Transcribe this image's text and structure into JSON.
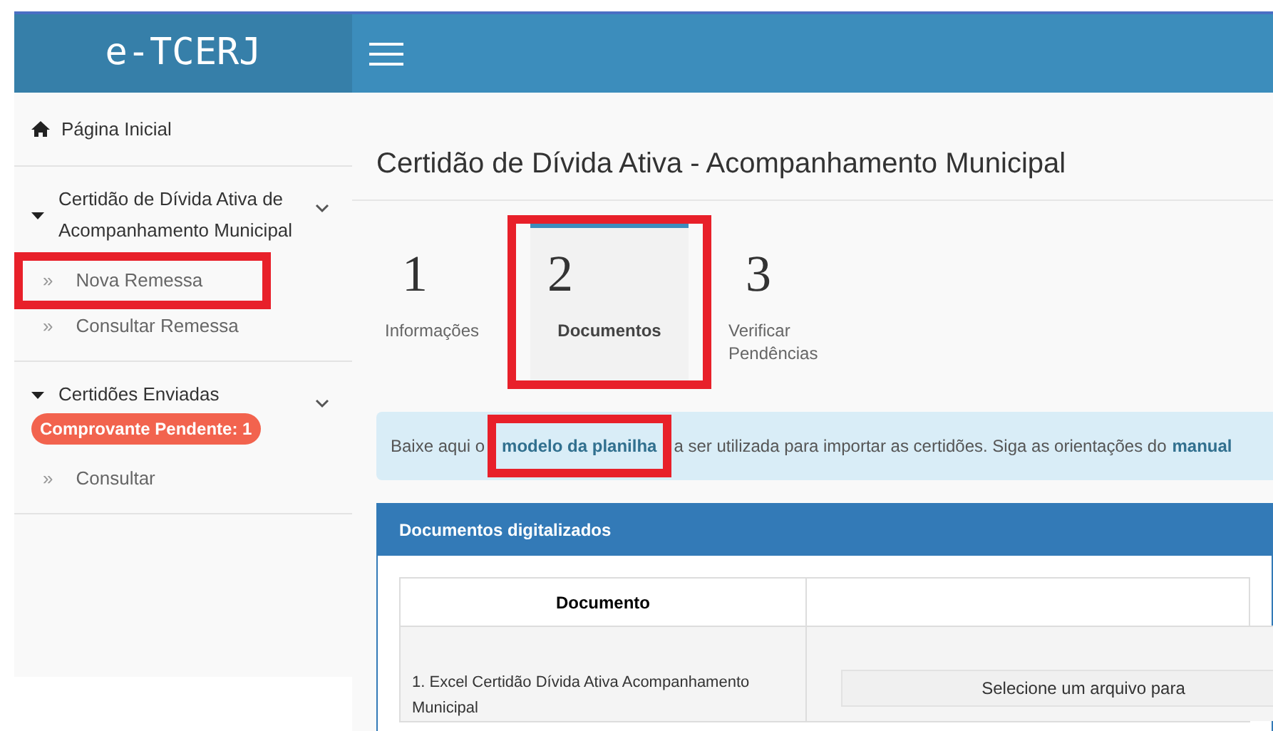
{
  "logo": "e-TCERJ",
  "sidebar": {
    "items": [
      {
        "kind": "link",
        "label": "Página Inicial"
      },
      {
        "kind": "group",
        "label": "Certidão de Dívida Ativa de Acompanhamento Municipal",
        "expanded": true,
        "children": [
          {
            "bullet": "»",
            "label": "Nova Remessa",
            "highlighted": true
          },
          {
            "bullet": "»",
            "label": "Consultar Remessa",
            "highlighted": false
          }
        ]
      },
      {
        "kind": "group",
        "label": "Certidões Enviadas",
        "badge": "Comprovante Pendente: 1",
        "expanded": true,
        "children": [
          {
            "bullet": "»",
            "label": "Consultar",
            "highlighted": false
          }
        ]
      }
    ]
  },
  "page_title": "Certidão de Dívida Ativa - Acompanhamento Municipal",
  "steps": [
    {
      "number": "1",
      "label": "Informações",
      "selected": false,
      "highlighted": false
    },
    {
      "number": "2",
      "label": "Documentos",
      "selected": true,
      "highlighted": true
    },
    {
      "number": "3",
      "label": "Verificar Pendências",
      "selected": false,
      "highlighted": false
    }
  ],
  "info": {
    "before": "Baixe aqui o",
    "link": "modelo da planilha",
    "link_highlighted": true,
    "after": "a ser utilizada para importar as certidões. Siga as orientações do",
    "link2": "manual"
  },
  "panel": {
    "title": "Documentos digitalizados",
    "columns": [
      "Documento"
    ],
    "rows": [
      {
        "document": "1. Excel Certidão Dívida Ativa Acompanhamento Municipal",
        "file_placeholder": "Selecione um arquivo para"
      }
    ]
  }
}
